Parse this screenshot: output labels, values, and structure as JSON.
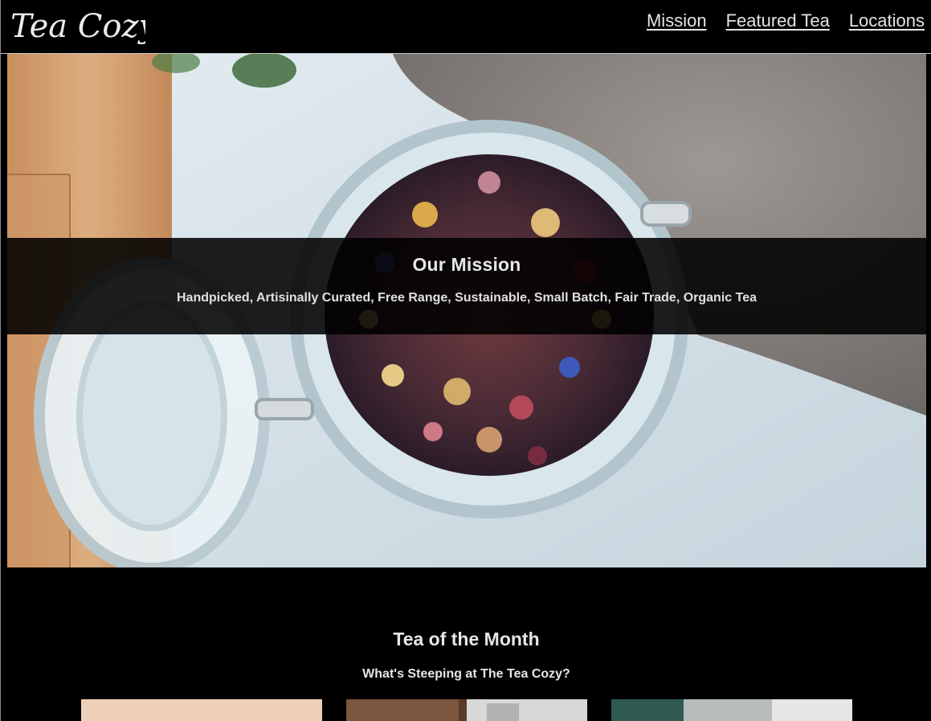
{
  "header": {
    "logo_text": "Tea Cozy",
    "nav": [
      {
        "label": "Mission"
      },
      {
        "label": "Featured Tea"
      },
      {
        "label": "Locations"
      }
    ]
  },
  "hero": {
    "image_icon": "tea-jar-image",
    "title": "Our Mission",
    "text": "Handpicked, Artisinally Curated, Free Range, Sustainable, Small Batch, Fair Trade, Organic Tea"
  },
  "tea_of_month": {
    "title": "Tea of the Month",
    "subtitle": "What's Steeping at The Tea Cozy?",
    "thumbnails": [
      {
        "icon": "tea-thumbnail-1"
      },
      {
        "icon": "tea-thumbnail-2"
      },
      {
        "icon": "tea-thumbnail-3"
      }
    ]
  },
  "colors": {
    "background": "#000000",
    "text": "#e6e6e6",
    "band": "rgba(0,0,0,0.88)"
  }
}
